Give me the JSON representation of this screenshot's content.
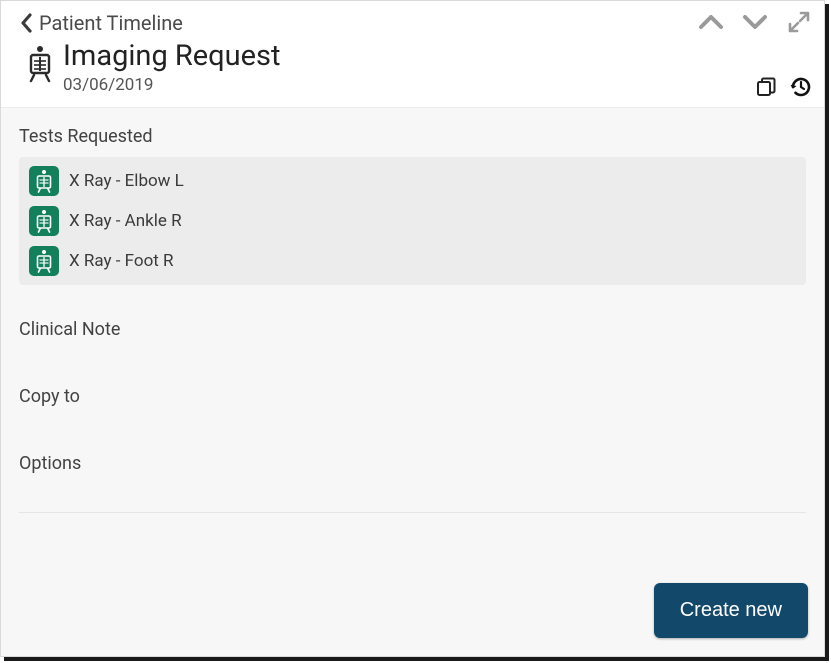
{
  "header": {
    "breadcrumb": "Patient Timeline",
    "title": "Imaging Request",
    "date": "03/06/2019"
  },
  "sections": {
    "tests_label": "Tests Requested",
    "clinical_note_label": "Clinical Note",
    "copy_to_label": "Copy to",
    "options_label": "Options"
  },
  "tests": [
    {
      "label": "X Ray - Elbow L"
    },
    {
      "label": "X Ray - Ankle R"
    },
    {
      "label": "X Ray - Foot R"
    }
  ],
  "footer": {
    "create_new_label": "Create new"
  },
  "colors": {
    "test_icon_bg": "#14805b",
    "primary_btn_bg": "#12496b"
  }
}
